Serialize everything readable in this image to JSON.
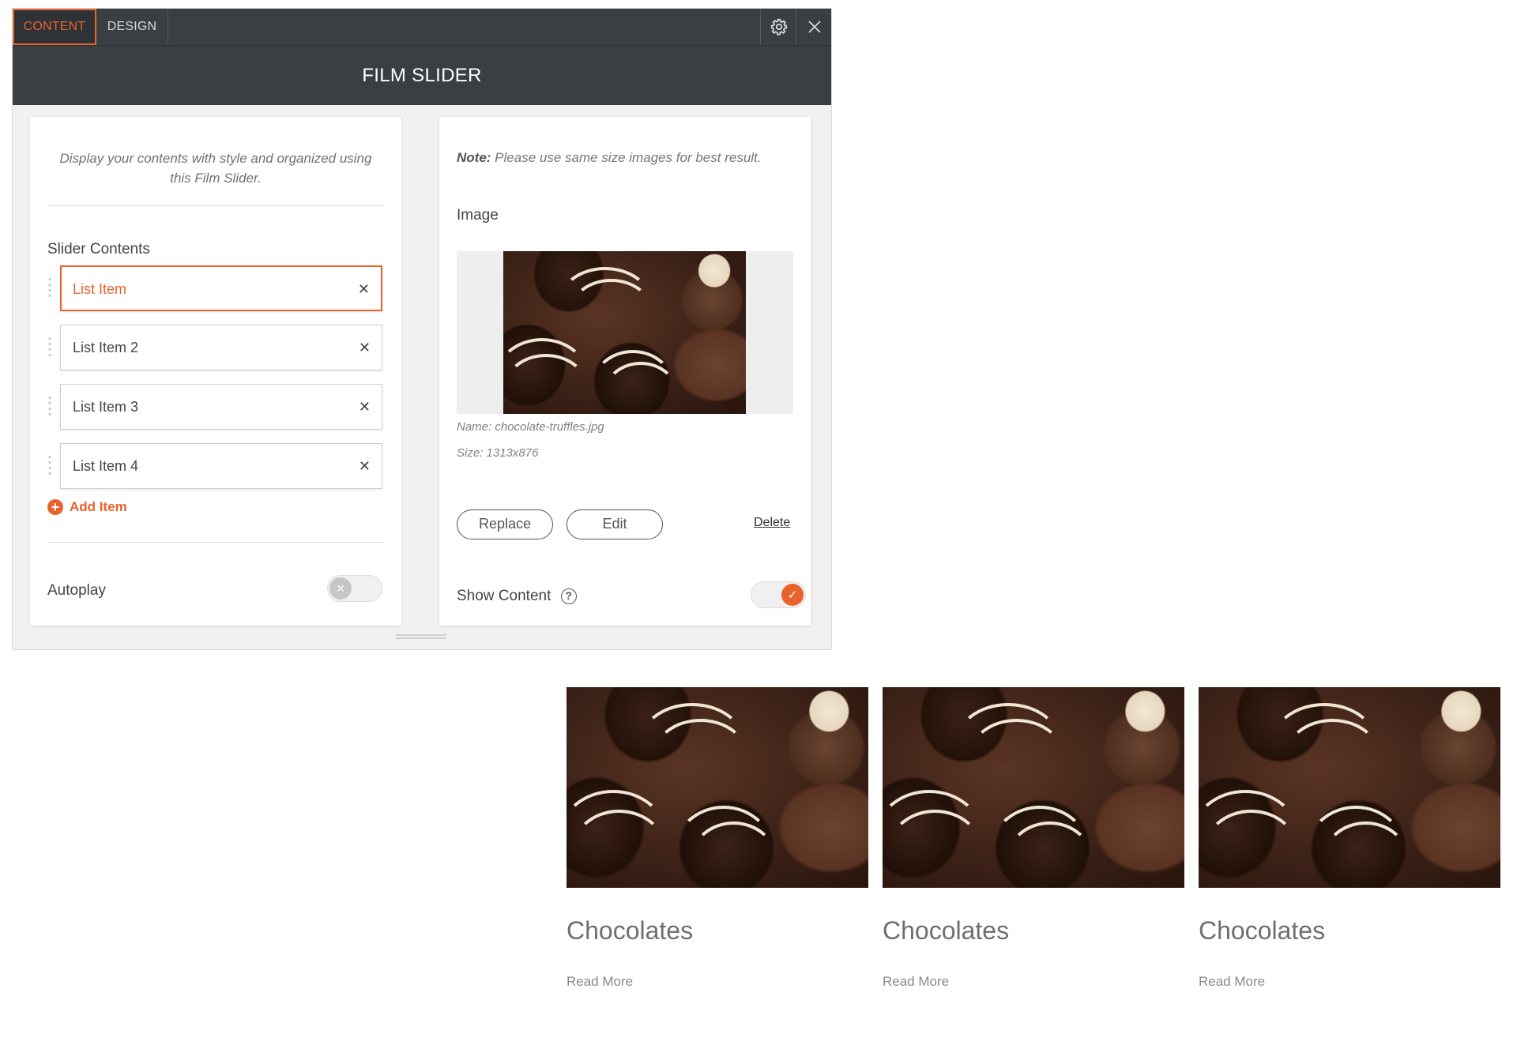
{
  "tabs": {
    "content": "CONTENT",
    "design": "DESIGN"
  },
  "icons": {
    "settings": "gear-icon",
    "close": "close-icon"
  },
  "panel_title": "FILM SLIDER",
  "left": {
    "intro": "Display your contents with style and organized using this Film Slider.",
    "slider_contents_label": "Slider Contents",
    "items": [
      {
        "label": "List Item"
      },
      {
        "label": "List Item 2"
      },
      {
        "label": "List Item 3"
      },
      {
        "label": "List Item 4"
      }
    ],
    "remove_glyph": "✕",
    "add_item": "Add Item",
    "autoplay_label": "Autoplay",
    "autoplay_on": false
  },
  "right": {
    "note_bold": "Note:",
    "note_text": " Please use same size images for best result.",
    "image_label": "Image",
    "name_line": "Name: chocolate-truffles.jpg",
    "size_line": "Size: 1313x876",
    "replace": "Replace",
    "edit": "Edit",
    "delete": "Delete",
    "show_content_label": "Show Content",
    "show_content_on": true
  },
  "preview": {
    "cards": [
      {
        "title": "Chocolates",
        "link": "Read More"
      },
      {
        "title": "Chocolates",
        "link": "Read More"
      },
      {
        "title": "Chocolates",
        "link": "Read More"
      }
    ]
  },
  "colors": {
    "accent": "#e8632c",
    "header": "#3a3f44"
  }
}
